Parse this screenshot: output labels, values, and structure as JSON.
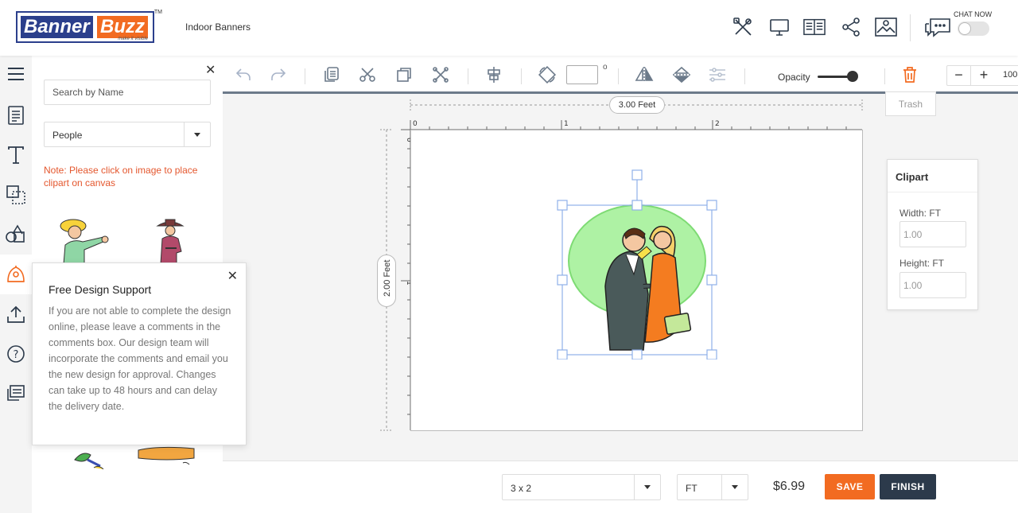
{
  "header": {
    "logo_part1": "Banner",
    "logo_part2": "Buzz",
    "logo_tagline": "make it visible",
    "logo_tm": "TM",
    "product_name": "Indoor Banners",
    "chat_now": "CHAT NOW",
    "icons": [
      "design-tools-icon",
      "desktop-preview-icon",
      "book-guide-icon",
      "share-icon",
      "image-icon",
      "chat-icon"
    ]
  },
  "iconbar": {
    "items": [
      "menu-icon",
      "templates-icon",
      "text-icon",
      "background-icon",
      "shapes-icon",
      "clipart-icon",
      "upload-icon",
      "help-icon",
      "comments-icon"
    ]
  },
  "panel": {
    "search_placeholder": "Search by Name",
    "category": "People",
    "note": "Note: Please click on image to place clipart on canvas"
  },
  "support": {
    "title": "Free Design Support",
    "body": "If you are not able to complete the design online, please leave a comments in the comments box. Our design team will incorporate the comments and email you the new design for approval. Changes can take up to 48 hours and can delay the delivery date."
  },
  "toolbar": {
    "degree_symbol": "o",
    "opacity_label": "Opacity",
    "opacity_value": 1.0,
    "zoom_minus": "−",
    "zoom_plus": "+",
    "zoom_value": "100",
    "trash_tooltip": "Trash"
  },
  "canvas": {
    "width_dim": "3.00 Feet",
    "height_dim": "2.00 Feet",
    "ruler_top": [
      "0",
      "1",
      "2"
    ],
    "ruler_left": [
      "0",
      "1"
    ]
  },
  "props": {
    "title": "Clipart",
    "width_label": "Width: FT",
    "width_placeholder": "1.00",
    "height_label": "Height: FT",
    "height_placeholder": "1.00"
  },
  "bottom": {
    "size": "3 x 2",
    "unit": "FT",
    "price": "$6.99",
    "save_label": "SAVE",
    "finish_label": "FINISH"
  },
  "colors": {
    "brand_blue": "#2b3f8c",
    "brand_orange": "#f26b21",
    "finish_dark": "#2c3a4b",
    "note_red": "#e4572e",
    "selection_blue": "#8fb0e8"
  }
}
